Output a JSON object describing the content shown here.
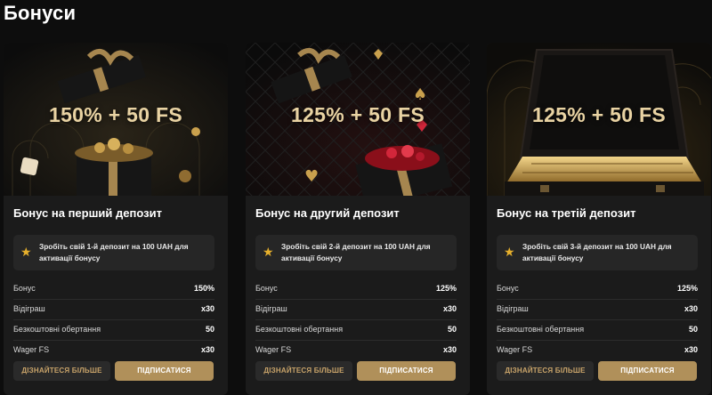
{
  "page": {
    "title": "Бонуси"
  },
  "colors": {
    "background": "#0d0d0d",
    "card": "#1b1b1b",
    "accent_gold": "#b0905a",
    "star": "#e7b02c"
  },
  "cards": [
    {
      "headline": "150% + 50 FS",
      "title": "Бонус на перший депозит",
      "notice": "Зробіть свій 1-й депозит на 100 UAH для активації бонусу",
      "rows": [
        {
          "label": "Бонус",
          "value": "150%"
        },
        {
          "label": "Відіграш",
          "value": "x30"
        },
        {
          "label": "Безкоштовні обертання",
          "value": "50"
        },
        {
          "label": "Wager FS",
          "value": "x30"
        }
      ],
      "more_label": "ДІЗНАЙТЕСЯ БІЛЬШЕ",
      "subscribe_label": "ПІДПИСАТИСЯ"
    },
    {
      "headline": "125% + 50 FS",
      "title": "Бонус на другий депозит",
      "notice": "Зробіть свій 2-й депозит на 100 UAH для активації бонусу",
      "rows": [
        {
          "label": "Бонус",
          "value": "125%"
        },
        {
          "label": "Відіграш",
          "value": "x30"
        },
        {
          "label": "Безкоштовні обертання",
          "value": "50"
        },
        {
          "label": "Wager FS",
          "value": "x30"
        }
      ],
      "more_label": "ДІЗНАЙТЕСЯ БІЛЬШЕ",
      "subscribe_label": "ПІДПИСАТИСЯ"
    },
    {
      "headline": "125% + 50 FS",
      "title": "Бонус на третій депозит",
      "notice": "Зробіть свій 3-й депозит на 100 UAH для активації бонусу",
      "rows": [
        {
          "label": "Бонус",
          "value": "125%"
        },
        {
          "label": "Відіграш",
          "value": "x30"
        },
        {
          "label": "Безкоштовні обертання",
          "value": "50"
        },
        {
          "label": "Wager FS",
          "value": "x30"
        }
      ],
      "more_label": "ДІЗНАЙТЕСЯ БІЛЬШЕ",
      "subscribe_label": "ПІДПИСАТИСЯ"
    }
  ]
}
